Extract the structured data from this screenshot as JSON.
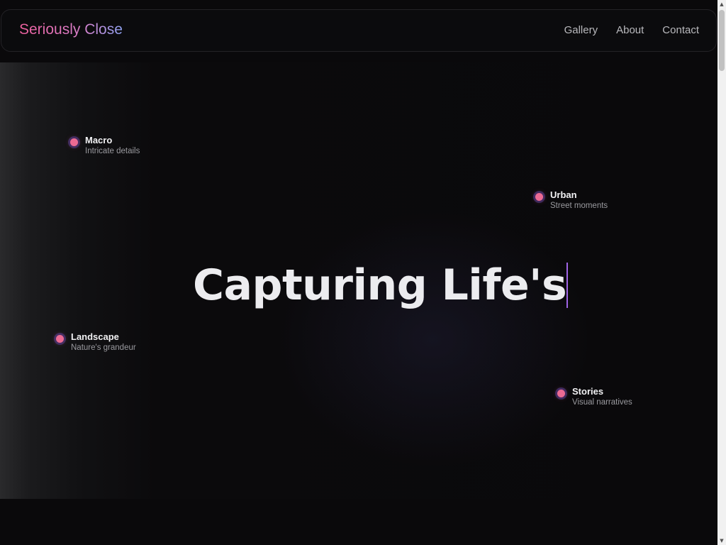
{
  "brand": {
    "name": "Seriously Close"
  },
  "nav": {
    "links": [
      {
        "label": "Gallery"
      },
      {
        "label": "About"
      },
      {
        "label": "Contact"
      }
    ]
  },
  "hero": {
    "headline": "Capturing Life's"
  },
  "tags": {
    "macro": {
      "title": "Macro",
      "subtitle": "Intricate details"
    },
    "urban": {
      "title": "Urban",
      "subtitle": "Street moments"
    },
    "landscape": {
      "title": "Landscape",
      "subtitle": "Nature's grandeur"
    },
    "stories": {
      "title": "Stories",
      "subtitle": "Visual narratives"
    }
  },
  "colors": {
    "background": "#0a090b",
    "brand_gradient_start": "#ec5f9c",
    "brand_gradient_end": "#8ea1f0",
    "accent_dot": "#ec6a93",
    "caret": "#a064e6",
    "headline": "#ececef"
  },
  "icons": {
    "scroll_up": "triangle-up-icon",
    "scroll_down": "triangle-down-icon",
    "tag_marker": "dot-icon"
  }
}
